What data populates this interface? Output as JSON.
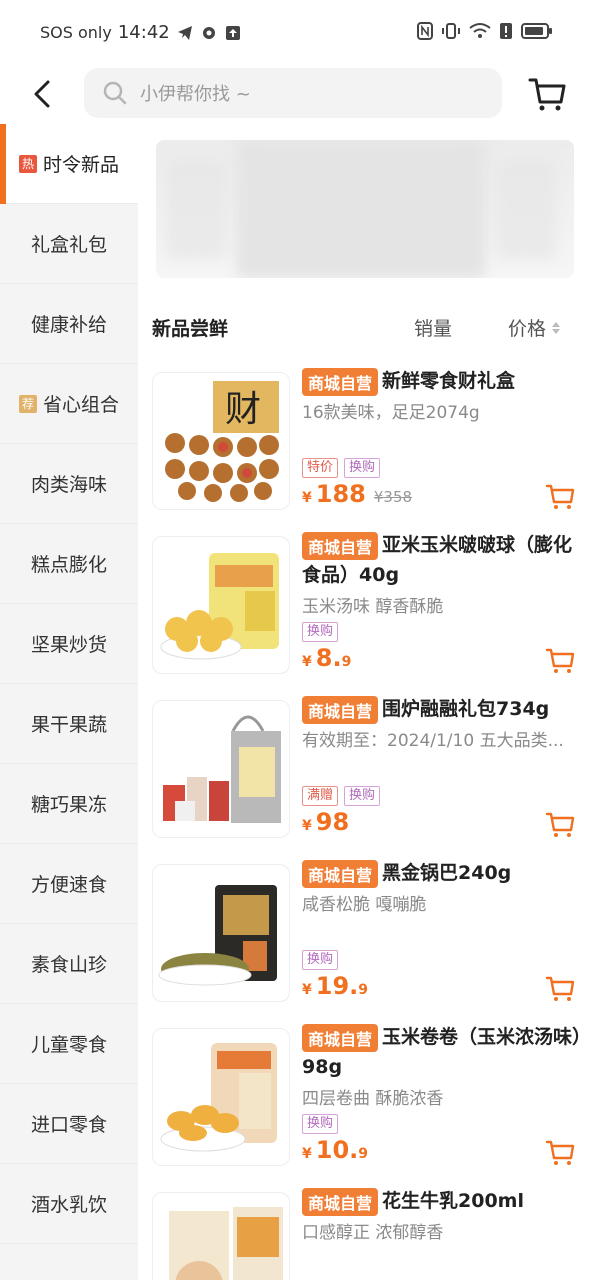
{
  "status_bar": {
    "carrier": "SOS only",
    "time": "14:42"
  },
  "header": {
    "search_placeholder": "小伊帮你找 ~"
  },
  "sidebar": {
    "items": [
      {
        "label": "时令新品",
        "badge": "热"
      },
      {
        "label": "礼盒礼包",
        "badge": ""
      },
      {
        "label": "健康补给",
        "badge": ""
      },
      {
        "label": "省心组合",
        "badge": "荐"
      },
      {
        "label": "肉类海味",
        "badge": ""
      },
      {
        "label": "糕点膨化",
        "badge": ""
      },
      {
        "label": "坚果炒货",
        "badge": ""
      },
      {
        "label": "果干果蔬",
        "badge": ""
      },
      {
        "label": "糖巧果冻",
        "badge": ""
      },
      {
        "label": "方便速食",
        "badge": ""
      },
      {
        "label": "素食山珍",
        "badge": ""
      },
      {
        "label": "儿童零食",
        "badge": ""
      },
      {
        "label": "进口零食",
        "badge": ""
      },
      {
        "label": "酒水乳饮",
        "badge": ""
      }
    ]
  },
  "list": {
    "title": "新品尝鲜",
    "sort_sales": "销量",
    "sort_price": "价格"
  },
  "products": [
    {
      "tag": "商城自营",
      "name": "新鲜零食财礼盒",
      "desc": "16款美味，足足2074g",
      "promo": [
        "特价",
        "换购"
      ],
      "currency": "¥",
      "price_int": "188",
      "price_dec": "",
      "orig_price": "¥358"
    },
    {
      "tag": "商城自营",
      "name": "亚米玉米啵啵球（膨化食品）40g",
      "desc": "玉米汤味 醇香酥脆",
      "promo": [
        "换购"
      ],
      "currency": "¥",
      "price_int": "8.",
      "price_dec": "9",
      "orig_price": ""
    },
    {
      "tag": "商城自营",
      "name": "围炉融融礼包734g",
      "desc": "有效期至：2024/1/10 五大品类...",
      "promo": [
        "满赠",
        "换购"
      ],
      "currency": "¥",
      "price_int": "98",
      "price_dec": "",
      "orig_price": ""
    },
    {
      "tag": "商城自营",
      "name": "黑金锅巴240g",
      "desc": "咸香松脆 嘎嘣脆",
      "promo": [
        "换购"
      ],
      "currency": "¥",
      "price_int": "19.",
      "price_dec": "9",
      "orig_price": ""
    },
    {
      "tag": "商城自营",
      "name": "玉米卷卷（玉米浓汤味）98g",
      "desc": "四层卷曲 酥脆浓香",
      "promo": [
        "换购"
      ],
      "currency": "¥",
      "price_int": "10.",
      "price_dec": "9",
      "orig_price": ""
    },
    {
      "tag": "商城自营",
      "name": "花生牛乳200ml",
      "desc": "口感醇正 浓郁醇香",
      "promo": [],
      "currency": "¥",
      "price_int": "",
      "price_dec": "",
      "orig_price": ""
    }
  ],
  "colors": {
    "accent": "#f07020",
    "tag_bg": "#f07f35"
  },
  "icons": {
    "back": "back-arrow-icon",
    "search": "search-icon",
    "cart": "cart-icon"
  }
}
